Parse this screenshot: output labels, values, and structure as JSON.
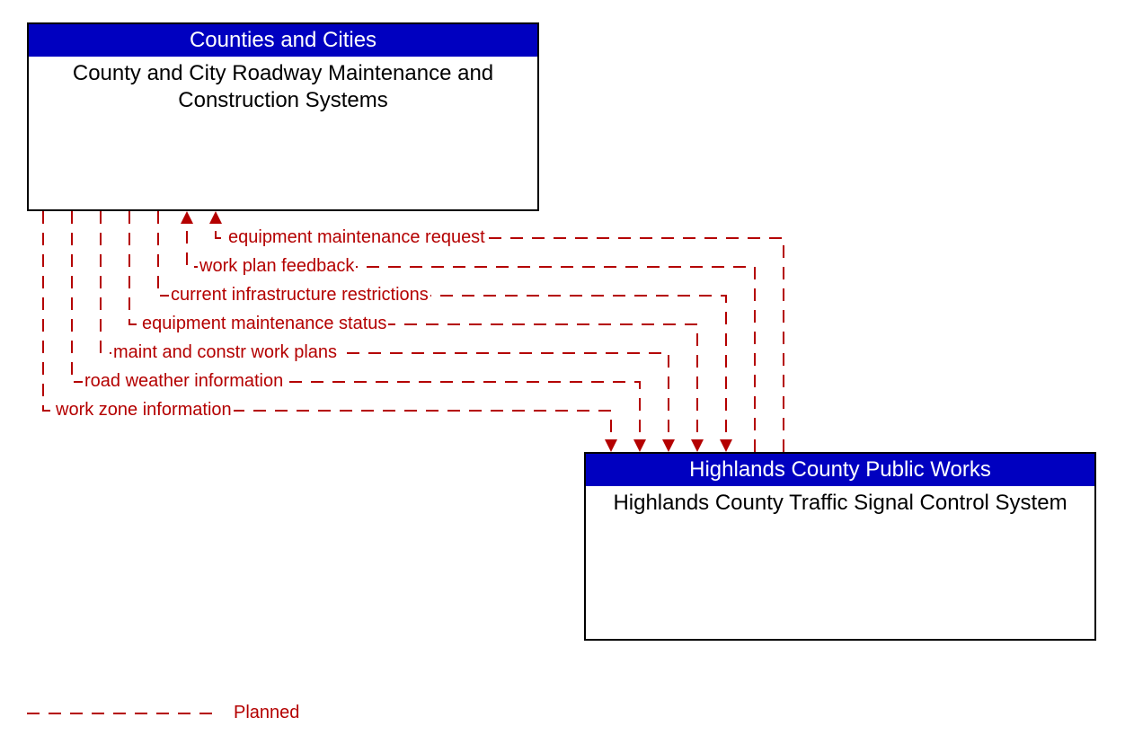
{
  "boxes": {
    "top": {
      "header": "Counties and Cities",
      "body": "County and City Roadway Maintenance and Construction Systems"
    },
    "bottom": {
      "header": "Highlands County Public Works",
      "body": "Highlands County Traffic Signal Control System"
    }
  },
  "flows": {
    "to_top": [
      "equipment maintenance request",
      "work plan feedback"
    ],
    "to_bottom": [
      "current infrastructure restrictions",
      "equipment maintenance status",
      "maint and constr work plans",
      "road weather information",
      "work zone information"
    ]
  },
  "legend": {
    "planned": "Planned"
  },
  "colors": {
    "header_bg": "#0000c0",
    "line": "#b40000"
  },
  "chart_data": {
    "type": "diagram",
    "nodes": [
      {
        "id": "county_city_rmc",
        "owner": "Counties and Cities",
        "label": "County and City Roadway Maintenance and Construction Systems"
      },
      {
        "id": "highlands_tscs",
        "owner": "Highlands County Public Works",
        "label": "Highlands County Traffic Signal Control System"
      }
    ],
    "edges": [
      {
        "from": "highlands_tscs",
        "to": "county_city_rmc",
        "label": "equipment maintenance request",
        "status": "Planned"
      },
      {
        "from": "highlands_tscs",
        "to": "county_city_rmc",
        "label": "work plan feedback",
        "status": "Planned"
      },
      {
        "from": "county_city_rmc",
        "to": "highlands_tscs",
        "label": "current infrastructure restrictions",
        "status": "Planned"
      },
      {
        "from": "county_city_rmc",
        "to": "highlands_tscs",
        "label": "equipment maintenance status",
        "status": "Planned"
      },
      {
        "from": "county_city_rmc",
        "to": "highlands_tscs",
        "label": "maint and constr work plans",
        "status": "Planned"
      },
      {
        "from": "county_city_rmc",
        "to": "highlands_tscs",
        "label": "road weather information",
        "status": "Planned"
      },
      {
        "from": "county_city_rmc",
        "to": "highlands_tscs",
        "label": "work zone information",
        "status": "Planned"
      }
    ],
    "legend": [
      {
        "style": "dashed",
        "color": "#b40000",
        "label": "Planned"
      }
    ]
  }
}
